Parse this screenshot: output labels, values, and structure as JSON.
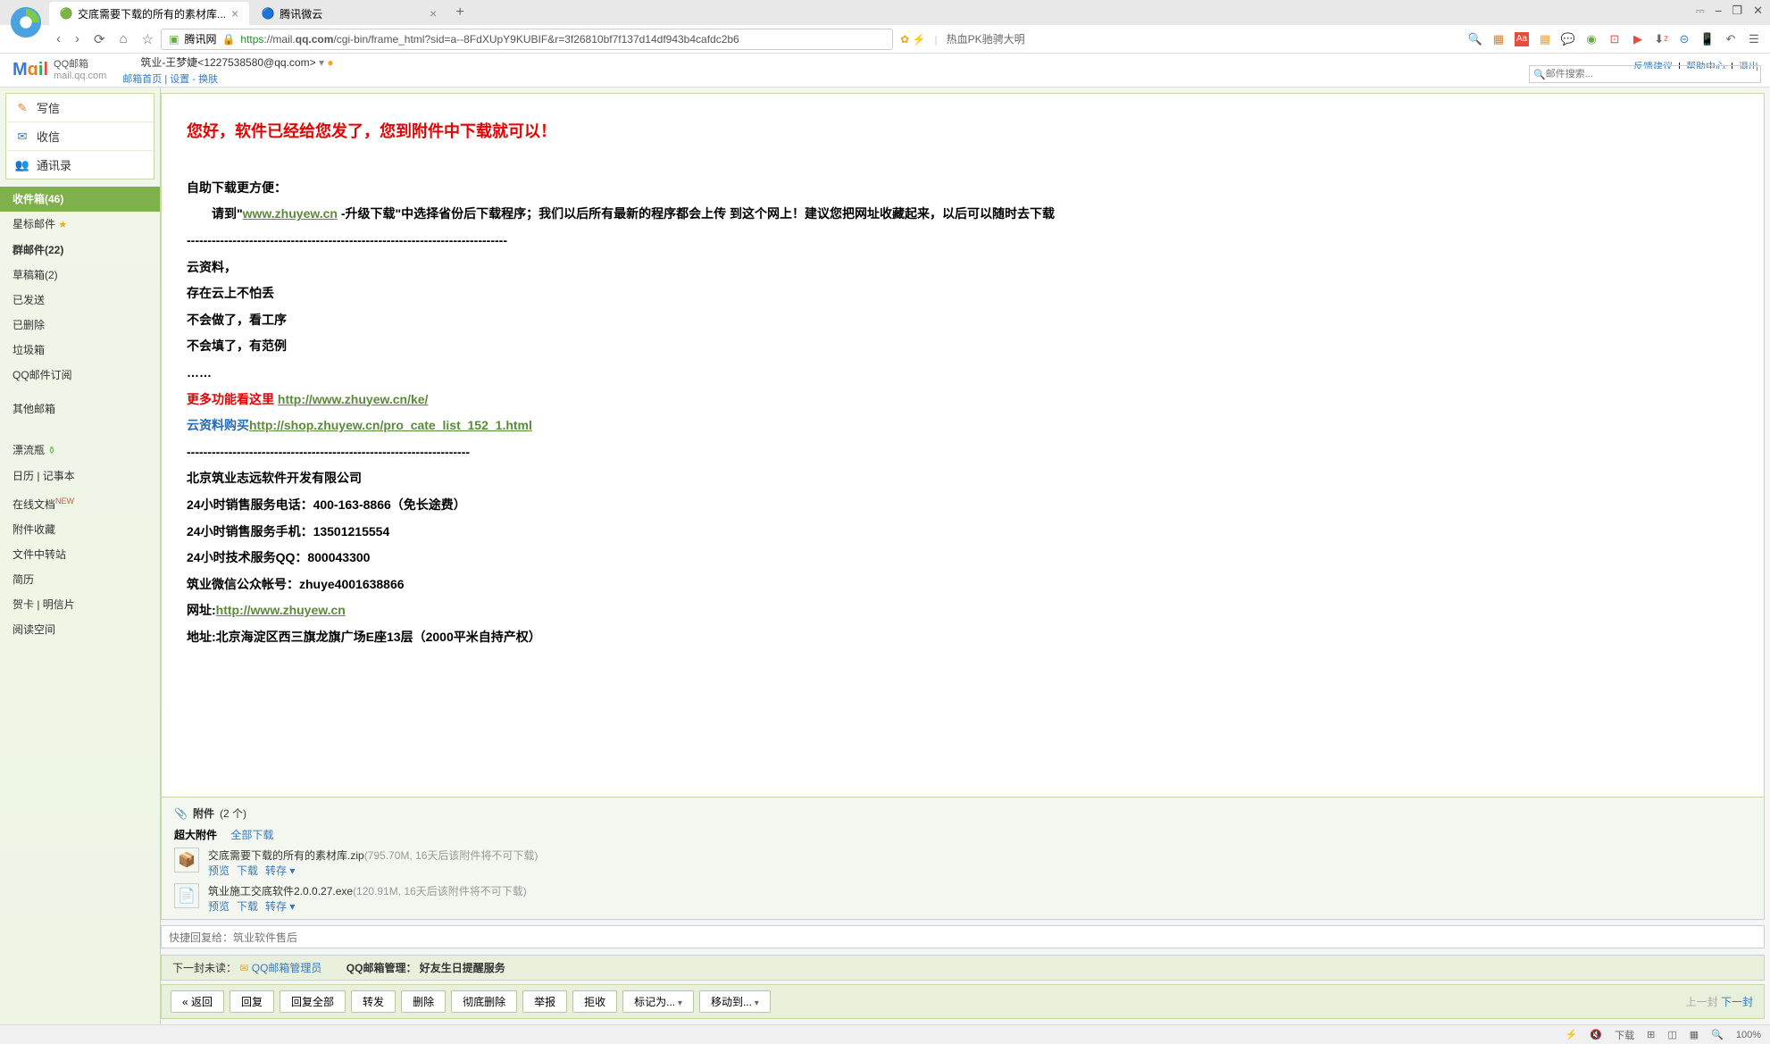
{
  "browser": {
    "tabs": [
      {
        "icon": "🟢",
        "title": "交底需要下载的所有的素材库...",
        "active": true
      },
      {
        "icon": "🔵",
        "title": "腾讯微云",
        "active": false
      }
    ],
    "window_controls": {
      "min": "⎯",
      "max": "☐",
      "restore": "❐",
      "close": "✕"
    },
    "nav": {
      "back": "‹",
      "forward": "›",
      "reload": "⟳",
      "home": "⌂",
      "star": "☆"
    },
    "url_label": "腾讯网",
    "lock": "🔒",
    "url": "https://mail.qq.com/cgi-bin/frame_html?sid=a--8FdXUpY9KUBIF&r=3f26810bf7f137d14df943b4cafdc2b6",
    "right_text": "热血PK驰骋大明",
    "toolbar_icons": [
      "🔍",
      "▦",
      "Aa",
      "▾",
      "📋",
      "▾",
      "💬",
      "▾",
      "🌐",
      "▾",
      "⊡",
      "📱",
      "⬇²",
      "⊝",
      "📱",
      "↶",
      "▾",
      "☰"
    ]
  },
  "header": {
    "logo_qq": "QQ邮箱",
    "logo_domain": "mail.qq.com",
    "account": "筑业-王梦婕<1227538580@qq.com>",
    "links": [
      "邮箱首页",
      "设置",
      "换肤"
    ],
    "right_links": [
      "反馈建议",
      "帮助中心",
      "退出"
    ],
    "search_placeholder": "邮件搜索..."
  },
  "sidebar": {
    "actions": [
      {
        "icon": "✉",
        "label": "写信",
        "color": "#e67e22"
      },
      {
        "icon": "📥",
        "label": "收信",
        "color": "#3878b9"
      },
      {
        "icon": "👥",
        "label": "通讯录",
        "color": "#7eb04b"
      }
    ],
    "folders": [
      {
        "label": "收件箱(46)",
        "active": true
      },
      {
        "label": "星标邮件 ",
        "star": true
      },
      {
        "label": "群邮件(22)",
        "bold": true
      },
      {
        "label": "草稿箱(2)"
      },
      {
        "label": "已发送"
      },
      {
        "label": "已删除"
      },
      {
        "label": "垃圾箱"
      },
      {
        "label": "QQ邮件订阅"
      }
    ],
    "other_label": "其他邮箱",
    "extras": [
      {
        "label": "漂流瓶 ",
        "bottle": true
      },
      {
        "label": "日历 | 记事本"
      },
      {
        "label": "在线文档",
        "new": true
      },
      {
        "label": "附件收藏"
      },
      {
        "label": "文件中转站"
      },
      {
        "label": "简历"
      },
      {
        "label": "贺卡 | 明信片"
      },
      {
        "label": "阅读空间"
      }
    ]
  },
  "email": {
    "greeting": "您好，软件已经给您发了，您到附件中下载就可以！",
    "self_dl_title": "自助下载更方便：",
    "self_dl_prefix": "　　请到\"",
    "self_dl_link": "www.zhuyew.cn",
    "self_dl_suffix": " -升级下载\"中选择省份后下载程序；我们以后所有最新的程序都会上传 到这个网上！建议您把网址收藏起来，以后可以随时去下载",
    "divider1": "-----------------------------------------------------------------------------",
    "cloud1": "云资料，",
    "cloud2": "存在云上不怕丢",
    "cloud3": "不会做了，看工序",
    "cloud4": "不会填了，有范例",
    "dots": "……",
    "more_label": "更多功能看这里 ",
    "more_link": "http://www.zhuyew.cn/ke/",
    "buy_label": "云资料购买",
    "buy_link": "http://shop.zhuyew.cn/pro_cate_list_152_1.html",
    "divider2": "--------------------------------------------------------------------",
    "company": "北京筑业志远软件开发有限公司",
    "phone1_label": "24小时销售服务电话：",
    "phone1": "400-163-8866（免长途费）",
    "phone2_label": "24小时销售服务手机：",
    "phone2": "13501215554",
    "qq_label": "24小时技术服务QQ：",
    "qq": "800043300",
    "wechat_label": "筑业微信公众帐号：",
    "wechat": "zhuye4001638866",
    "site_label": "网址:",
    "site_link": "http://www.zhuyew.cn",
    "addr_label": "地址:",
    "addr": "北京海淀区西三旗龙旗广场E座13层（2000平米自持产权）"
  },
  "attachments": {
    "title": "附件",
    "count": "(2 个)",
    "big_label": "超大附件",
    "download_all": "全部下载",
    "items": [
      {
        "icon": "📦",
        "name": "交底需要下载的所有的素材库.zip",
        "meta": "(795.70M, 16天后该附件将不可下载)"
      },
      {
        "icon": "📄",
        "name": "筑业施工交底软件2.0.0.27.exe",
        "meta": "(120.91M, 16天后该附件将不可下载)"
      }
    ],
    "actions": [
      "预览",
      "下载",
      "转存 ▾"
    ]
  },
  "quick_reply": {
    "placeholder": "快捷回复给：筑业软件售后"
  },
  "next_mail": {
    "label": "下一封未读：",
    "sender": "QQ邮箱管理员",
    "sep": "QQ邮箱管理：",
    "subject": "好友生日提醒服务"
  },
  "toolbar": {
    "buttons": [
      "« 返回",
      "回复",
      "回复全部",
      "转发",
      "删除",
      "彻底删除",
      "举报",
      "拒收",
      "标记为...",
      "移动到..."
    ],
    "prev": "上一封",
    "next": "下一封"
  },
  "status": {
    "downloads": "下载",
    "zoom": "100%"
  }
}
